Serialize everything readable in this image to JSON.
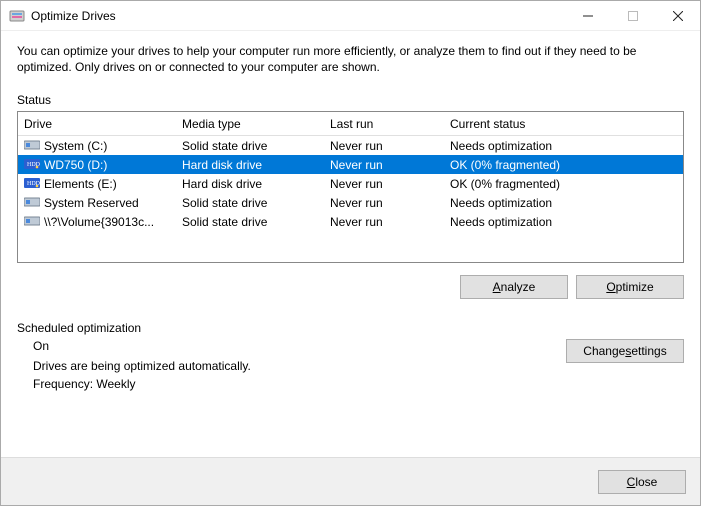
{
  "window": {
    "title": "Optimize Drives"
  },
  "description": "You can optimize your drives to help your computer run more efficiently, or analyze them to find out if they need to be optimized. Only drives on or connected to your computer are shown.",
  "status_label": "Status",
  "columns": {
    "drive": "Drive",
    "media": "Media type",
    "lastrun": "Last run",
    "status": "Current status"
  },
  "drives": [
    {
      "name": "System (C:)",
      "media": "Solid state drive",
      "lastrun": "Never run",
      "status": "Needs optimization",
      "selected": false,
      "icon": "ssd"
    },
    {
      "name": "WD750 (D:)",
      "media": "Hard disk drive",
      "lastrun": "Never run",
      "status": "OK (0% fragmented)",
      "selected": true,
      "icon": "hdd"
    },
    {
      "name": "Elements (E:)",
      "media": "Hard disk drive",
      "lastrun": "Never run",
      "status": "OK (0% fragmented)",
      "selected": false,
      "icon": "hdd"
    },
    {
      "name": "System Reserved",
      "media": "Solid state drive",
      "lastrun": "Never run",
      "status": "Needs optimization",
      "selected": false,
      "icon": "ssd"
    },
    {
      "name": "\\\\?\\Volume{39013c...",
      "media": "Solid state drive",
      "lastrun": "Never run",
      "status": "Needs optimization",
      "selected": false,
      "icon": "ssd"
    }
  ],
  "buttons": {
    "analyze_pre": "",
    "analyze_ul": "A",
    "analyze_post": "nalyze",
    "optimize_pre": "",
    "optimize_ul": "O",
    "optimize_post": "ptimize",
    "change_pre": "Change ",
    "change_ul": "s",
    "change_post": "ettings",
    "close_pre": "",
    "close_ul": "C",
    "close_post": "lose"
  },
  "scheduled": {
    "label": "Scheduled optimization",
    "on": "On",
    "line1": "Drives are being optimized automatically.",
    "line2": "Frequency: Weekly"
  }
}
